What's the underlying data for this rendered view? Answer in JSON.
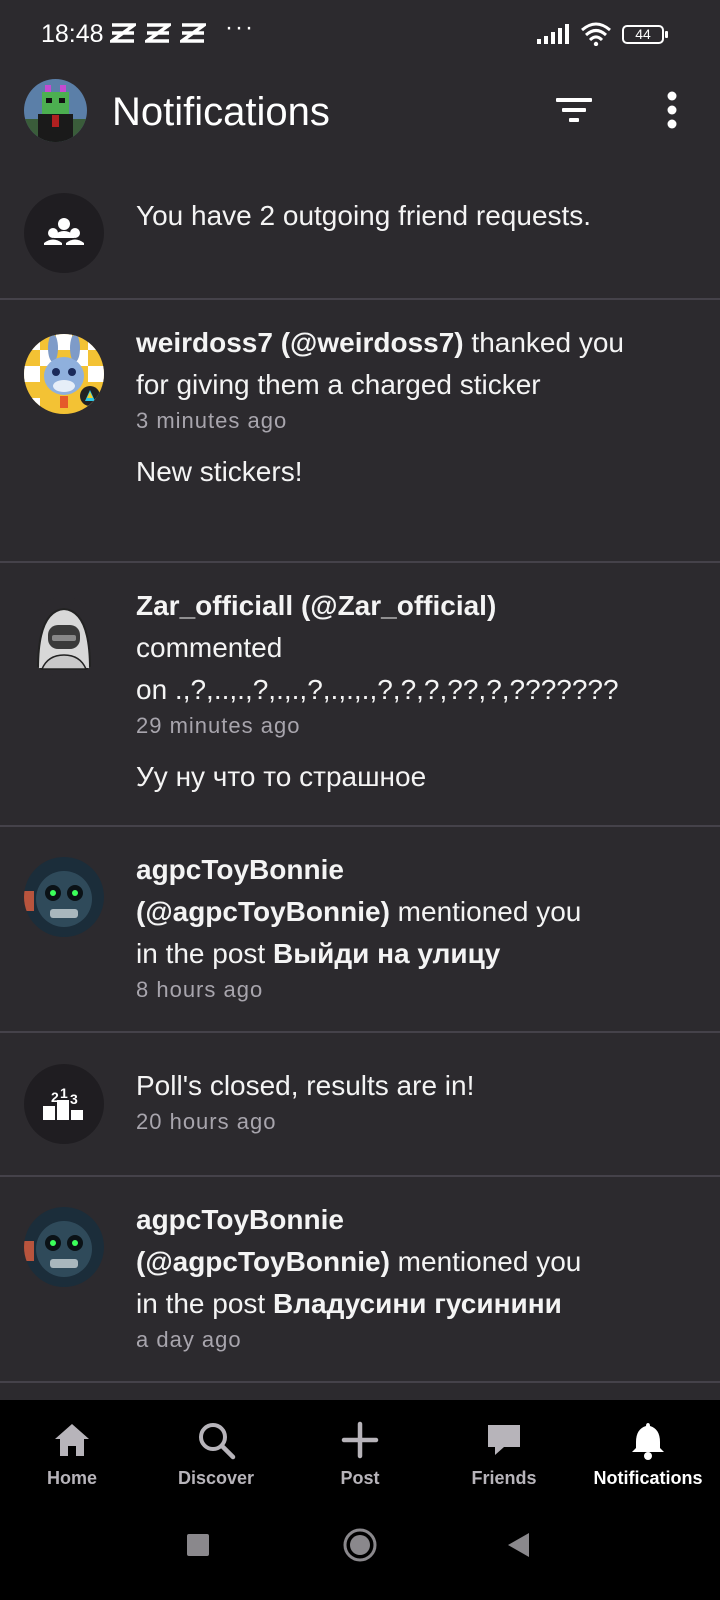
{
  "status_bar": {
    "time": "18:48",
    "overflow": "···",
    "battery": "44"
  },
  "header": {
    "title": "Notifications"
  },
  "notifications": [
    {
      "text": "You have 2 outgoing friend requests."
    },
    {
      "actor": "weirdoss7 (@weirdoss7)",
      "action": " thanked you for giving them a charged sticker",
      "time": "3 minutes ago",
      "extra": "New stickers!"
    },
    {
      "actor": "Zar_officiall (@Zar_official)",
      "action_line1": "commented",
      "action_line2": "on .,?,..,.,?,.,.,?,.,.,.,?,?,?,??,?,???????",
      "time": "29 minutes ago",
      "extra": "Уу ну что то страшное"
    },
    {
      "actor_line1": "agpcToyBonnie",
      "actor_line2": "(@agpcToyBonnie)",
      "action": " mentioned you",
      "prefix": "in the post ",
      "post": "Выйди на улицу",
      "time": "8 hours ago"
    },
    {
      "text": "Poll's closed, results are in!",
      "time": "20 hours ago"
    },
    {
      "actor_line1": "agpcToyBonnie",
      "actor_line2": "(@agpcToyBonnie)",
      "action": " mentioned you",
      "prefix": "in the post ",
      "post": "Владусини гусинини",
      "time": "a day ago"
    }
  ],
  "bottom_nav": [
    {
      "label": "Home",
      "icon": "home-icon"
    },
    {
      "label": "Discover",
      "icon": "search-icon"
    },
    {
      "label": "Post",
      "icon": "plus-icon"
    },
    {
      "label": "Friends",
      "icon": "chat-bubble-icon"
    },
    {
      "label": "Notifications",
      "icon": "bell-icon",
      "active": true
    }
  ],
  "colors": {
    "background": "#2c2a2e",
    "divider": "#45424a",
    "nav_bg": "#000000",
    "muted_text": "#a8a5ad"
  }
}
